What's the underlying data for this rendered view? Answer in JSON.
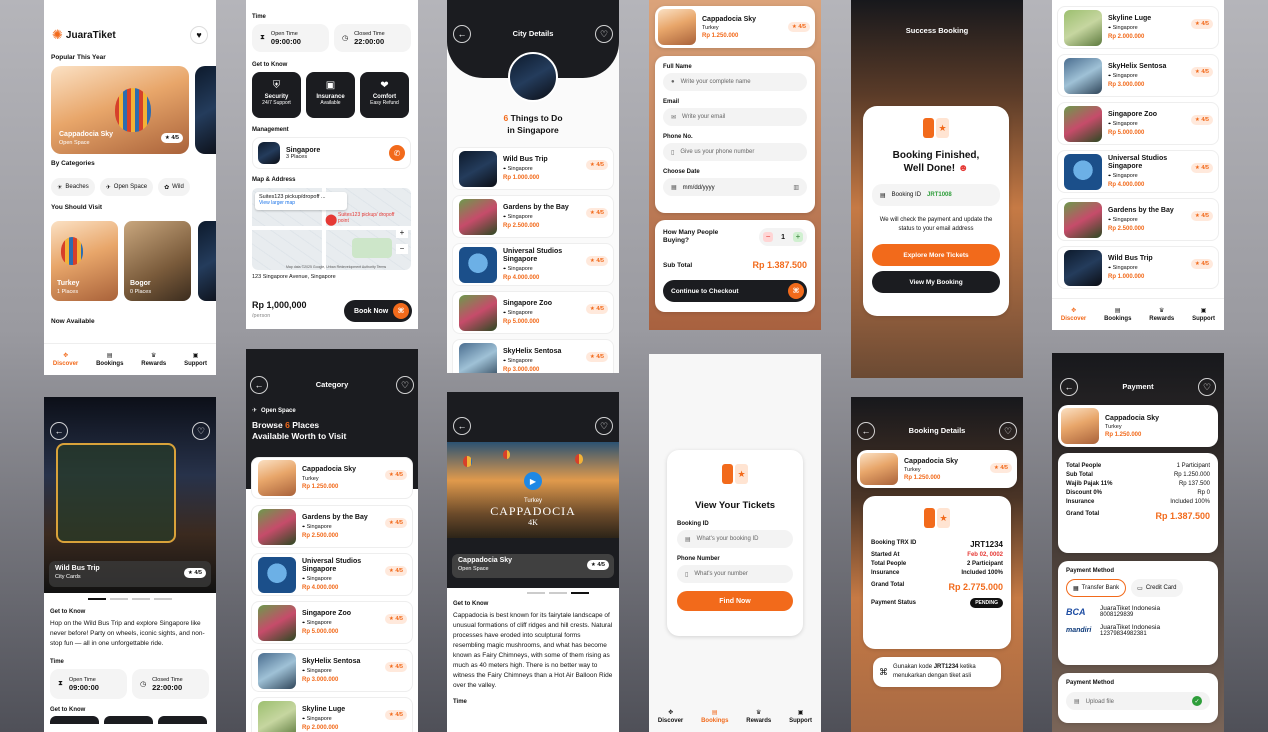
{
  "brand": "JuaraTiket",
  "nav": {
    "discover": "Discover",
    "bookings": "Bookings",
    "rewards": "Rewards",
    "support": "Support"
  },
  "home": {
    "popular": "Popular This Year",
    "card_name": "Cappadocia Sky",
    "card_sub": "Open Space",
    "card_rate": "4/5",
    "by_categories": "By Categories",
    "cats": [
      "Beaches",
      "Open Space",
      "Wild"
    ],
    "should_visit": "You Should Visit",
    "visits": [
      {
        "name": "Turkey",
        "sub": "1 Places"
      },
      {
        "name": "Bogor",
        "sub": "0 Places"
      }
    ],
    "now_available": "Now Available"
  },
  "detail2": {
    "time": "Time",
    "open_label": "Open Time",
    "open": "09:00:00",
    "closed_label": "Closed Time",
    "closed": "22:00:00",
    "get_to_know": "Get to Know",
    "features": [
      {
        "t": "Security",
        "s": "24/7 Support"
      },
      {
        "t": "Insurance",
        "s": "Available"
      },
      {
        "t": "Comfort",
        "s": "Easy Refund"
      }
    ],
    "management": "Management",
    "mgmt_name": "Singapore",
    "mgmt_sub": "3 Places",
    "map": "Map & Address",
    "map_popup": "Suites123 pickup/dropoff ...",
    "map_link": "View larger map",
    "map_pin": "Suites123 pickup/ dropoff point",
    "map_footer": "Map data ©2025 Google, Urban Redevelopment Authority  Terms",
    "address": "123 Singapore Avenue, Singapore",
    "price": "Rp 1,000,000",
    "per": "/person",
    "book": "Book Now"
  },
  "city": {
    "title": "City Details",
    "heading_num": "6",
    "heading_a": "Things to Do",
    "heading_b": "in Singapore"
  },
  "places": [
    {
      "name": "Wild Bus Trip",
      "loc": "Singapore",
      "price": "Rp 1.000.000",
      "rate": "4/5"
    },
    {
      "name": "Gardens by the Bay",
      "loc": "Singapore",
      "price": "Rp 2.500.000",
      "rate": "4/5"
    },
    {
      "name": "Universal Studios Singapore",
      "loc": "Singapore",
      "price": "Rp 4.000.000",
      "rate": "4/5"
    },
    {
      "name": "Singapore Zoo",
      "loc": "Singapore",
      "price": "Rp 5.000.000",
      "rate": "4/5"
    },
    {
      "name": "SkyHelix Sentosa",
      "loc": "Singapore",
      "price": "Rp 3.000.000",
      "rate": "4/5"
    },
    {
      "name": "Skyline Luge",
      "loc": "Singapore",
      "price": "Rp 2.000.000",
      "rate": "4/5"
    }
  ],
  "checkout": {
    "item": "Cappadocia Sky",
    "item_loc": "Turkey",
    "item_price": "Rp 1.250.000",
    "rate": "4/5",
    "full_name": "Full Name",
    "full_ph": "Write your complete name",
    "email": "Email",
    "email_ph": "Write your email",
    "phone": "Phone No.",
    "phone_ph": "Give us your phone number",
    "date": "Choose Date",
    "date_ph": "mm/dd/yyyy",
    "how_many": "How Many People Buying?",
    "qty": "1",
    "subtotal": "Sub Total",
    "subtotal_val": "Rp 1.387.500",
    "continue": "Continue to Checkout"
  },
  "success": {
    "title": "Success Booking",
    "h1": "Booking Finished,",
    "h2": "Well Done!",
    "id_label": "Booking ID",
    "id": "JRT1008",
    "msg": "We will check the payment and update the status to your email address",
    "explore": "Explore More Tickets",
    "view": "View My Booking"
  },
  "list2": {
    "names": [
      "Skyline Luge",
      "SkyHelix Sentosa",
      "Singapore Zoo",
      "Universal Studios Singapore",
      "Gardens by the Bay",
      "Wild Bus Trip"
    ],
    "prices": [
      "Rp 2.000.000",
      "Rp 3.000.000",
      "Rp 5.000.000",
      "Rp 4.000.000",
      "Rp 2.500.000",
      "Rp 1.000.000"
    ]
  },
  "bus": {
    "name": "Wild Bus Trip",
    "sub": "City Cards",
    "rate": "4/5",
    "gtk": "Get to Know",
    "desc": "Hop on the Wild Bus Trip and explore Singapore like never before! Party on wheels, iconic sights, and non-stop fun — all in one unforgettable ride.",
    "time": "Time",
    "open_label": "Open Time",
    "open": "09:00:00",
    "closed_label": "Closed Time",
    "closed": "22:00:00",
    "gtk2": "Get to Know"
  },
  "category": {
    "title": "Category",
    "tag": "Open Space",
    "browse_a": "Browse",
    "num": "6",
    "browse_b": "Places",
    "browse_c": "Available Worth to Visit",
    "first": {
      "name": "Cappadocia Sky",
      "loc": "Turkey",
      "price": "Rp 1.250.000",
      "rate": "4/5"
    }
  },
  "video": {
    "banner_a": "Turkey",
    "banner_b": "CAPPADOCIA",
    "banner_c": "4K",
    "name": "Cappadocia Sky",
    "sub": "Open Space",
    "rate": "4/5",
    "gtk": "Get to Know",
    "desc": "Cappadocia is best known for its fairytale landscape of unusual formations of cliff ridges and hill crests. Natural processes have eroded into sculptural forms resembling magic mushrooms, and what has become known as Fairy Chimneys, with some of them rising as much as 40 meters high. There is no better way to witness the Fairy Chimneys than a Hot Air Balloon Ride over the valley.",
    "time": "Time"
  },
  "tickets": {
    "title": "View Your Tickets",
    "id_label": "Booking ID",
    "id_ph": "What's your booking ID",
    "phone_label": "Phone Number",
    "phone_ph": "What's your number",
    "find": "Find Now"
  },
  "bdetail": {
    "title": "Booking Details",
    "item": "Cappadocia Sky",
    "item_loc": "Turkey",
    "item_price": "Rp 1.250.000",
    "rate": "4/5",
    "rows": [
      [
        "Booking TRX ID",
        "JRT1234"
      ],
      [
        "Started At",
        "Feb 02, 0002"
      ],
      [
        "Total People",
        "2 Participant"
      ],
      [
        "Insurance",
        "Included 100%"
      ]
    ],
    "grand": "Grand Total",
    "grand_val": "Rp 2.775.000",
    "status": "Payment Status",
    "status_val": "PENDING",
    "note_a": "Gunakan kode",
    "note_code": "JRT1234",
    "note_b": "ketika menukarkan dengan tiket asli"
  },
  "payment": {
    "title": "Payment",
    "item": "Cappadocia Sky",
    "item_loc": "Turkey",
    "item_price": "Rp 1.250.000",
    "rows": [
      [
        "Total People",
        "1 Participant"
      ],
      [
        "Sub Total",
        "Rp 1.250.000"
      ],
      [
        "Wajib Pajak 11%",
        "Rp 137.500"
      ],
      [
        "Discount 0%",
        "Rp 0"
      ],
      [
        "Insurance",
        "Included 100%"
      ]
    ],
    "grand": "Grand Total",
    "grand_val": "Rp 1.387.500",
    "method": "Payment Method",
    "transfer": "Transfer Bank",
    "credit": "Credit Card",
    "banks": [
      {
        "logo": "BCA",
        "name": "JuaraTiket Indonesia",
        "num": "8008129839"
      },
      {
        "logo": "mandiri",
        "name": "JuaraTiket Indonesia",
        "num": "12379834982381"
      }
    ],
    "method2": "Payment Method",
    "upload": "Upload file"
  }
}
